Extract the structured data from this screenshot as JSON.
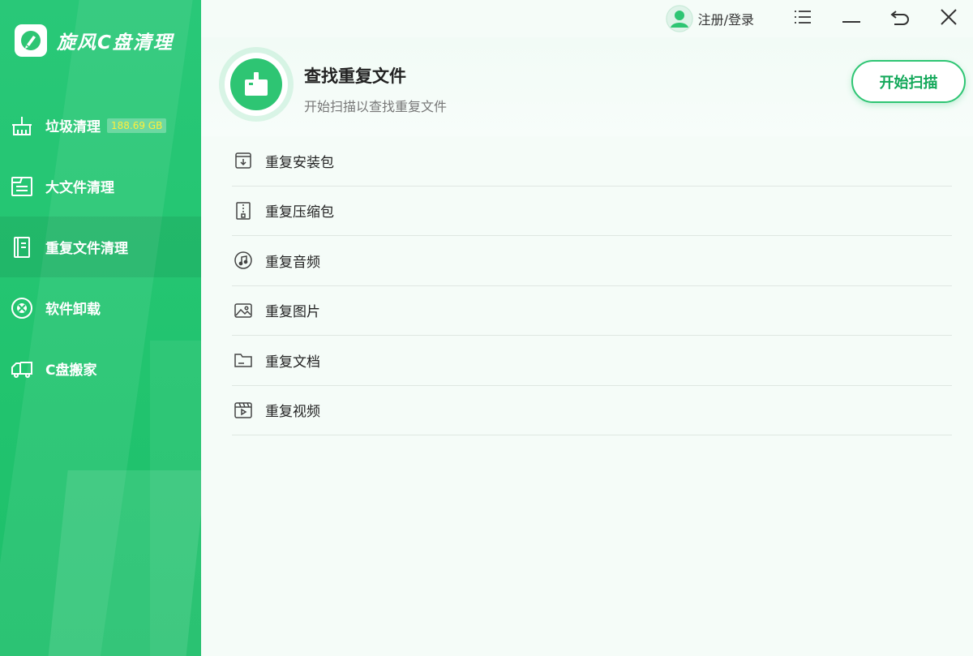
{
  "app": {
    "title": "旋风C盘清理"
  },
  "sidebar": {
    "items": [
      {
        "label": "垃圾清理",
        "badge": "188.69 GB",
        "icon": "broom-icon",
        "active": false
      },
      {
        "label": "大文件清理",
        "icon": "large-file-icon",
        "active": false
      },
      {
        "label": "重复文件清理",
        "icon": "duplicate-file-icon",
        "active": true
      },
      {
        "label": "软件卸载",
        "icon": "uninstall-icon",
        "active": false
      },
      {
        "label": "C盘搬家",
        "icon": "move-truck-icon",
        "active": false
      }
    ]
  },
  "topbar": {
    "user_label": "注册/登录"
  },
  "header": {
    "title": "查找重复文件",
    "subtitle": "开始扫描以查找重复文件",
    "scan_button": "开始扫描"
  },
  "categories": [
    {
      "label": "重复安装包",
      "icon": "package-download-icon"
    },
    {
      "label": "重复压缩包",
      "icon": "zip-archive-icon"
    },
    {
      "label": "重复音频",
      "icon": "music-note-icon"
    },
    {
      "label": "重复图片",
      "icon": "image-icon"
    },
    {
      "label": "重复文档",
      "icon": "folder-document-icon"
    },
    {
      "label": "重复视频",
      "icon": "video-clapper-icon"
    }
  ],
  "colors": {
    "accent": "#2ec573",
    "badge_text": "#ffef3a",
    "sidebar": "#22c46f"
  }
}
